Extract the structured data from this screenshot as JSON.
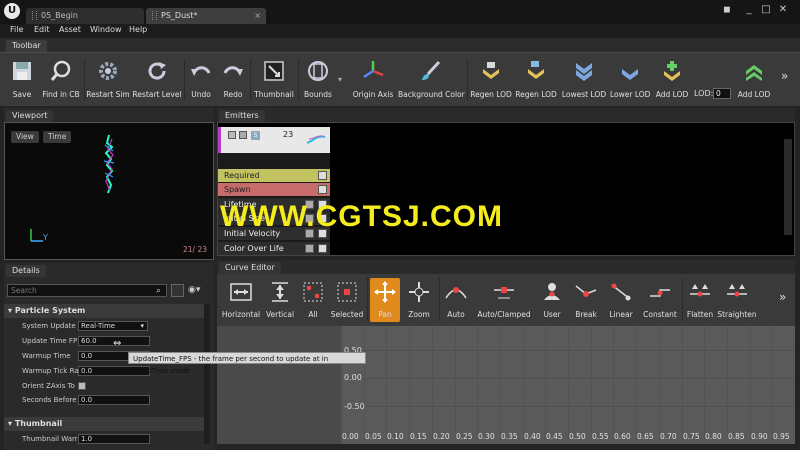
{
  "tabs": [
    {
      "label": "05_Begin"
    },
    {
      "label": "PS_Dust*"
    }
  ],
  "menu": [
    "File",
    "Edit",
    "Asset",
    "Window",
    "Help"
  ],
  "toolbar": {
    "title": "Toolbar",
    "buttons": [
      {
        "label": "Save",
        "icon": "save-icon"
      },
      {
        "label": "Find in CB",
        "icon": "magnifier-icon"
      },
      {
        "label": "Restart Sim",
        "icon": "gear-restart-icon"
      },
      {
        "label": "Restart Level",
        "icon": "refresh-icon"
      },
      {
        "label": "Undo",
        "icon": "undo-icon"
      },
      {
        "label": "Redo",
        "icon": "redo-icon"
      },
      {
        "label": "Thumbnail",
        "icon": "thumbnail-icon"
      },
      {
        "label": "Bounds",
        "icon": "bounds-icon"
      },
      {
        "label": "Origin Axis",
        "icon": "axis-icon"
      },
      {
        "label": "Background Color",
        "icon": "brush-icon"
      },
      {
        "label": "Regen LOD",
        "icon": "regen-lod-icon"
      },
      {
        "label": "Regen LOD",
        "icon": "regen-lod-icon"
      },
      {
        "label": "Lowest LOD",
        "icon": "lowest-lod-icon"
      },
      {
        "label": "Lower LOD",
        "icon": "lower-lod-icon"
      },
      {
        "label": "Add LOD",
        "icon": "add-lod-icon"
      },
      {
        "label": "Add LOD",
        "icon": "add-lod-icon"
      }
    ],
    "lod_label": "LOD:",
    "lod_value": "0"
  },
  "viewport": {
    "title": "Viewport",
    "view_btn": "View",
    "time_btn": "Time",
    "axis_y": "Y",
    "frame_counter": "21/ 23"
  },
  "details": {
    "title": "Details",
    "search_placeholder": "Search",
    "section_particle": "Particle System",
    "props": [
      {
        "label": "System Update",
        "value": "Real-Time"
      },
      {
        "label": "Update Time FP",
        "value": "60.0"
      },
      {
        "label": "Warmup Time",
        "value": "0.0"
      },
      {
        "label": "Warmup Tick Ra",
        "value": "0.0"
      },
      {
        "label": "Orient ZAxis To",
        "value": ""
      },
      {
        "label": "Seconds Before",
        "value": "0.0"
      }
    ],
    "section_thumbnail": "Thumbnail",
    "thumb_label": "Thumbnail Warr",
    "thumb_value": "1.0"
  },
  "tooltip": "UpdateTime_FPS - the frame per second to update at in FixedTime mode",
  "emitters": {
    "title": "Emitters",
    "count": "23",
    "modules": [
      "Required",
      "Spawn",
      "Lifetime",
      "Initial Size",
      "Initial Velocity",
      "Color Over Life"
    ]
  },
  "curve_editor": {
    "title": "Curve Editor",
    "buttons": [
      {
        "label": "Horizontal",
        "icon": "fit-horizontal-icon"
      },
      {
        "label": "Vertical",
        "icon": "fit-vertical-icon"
      },
      {
        "label": "All",
        "icon": "fit-all-icon"
      },
      {
        "label": "Selected",
        "icon": "fit-selected-icon"
      },
      {
        "label": "Pan",
        "icon": "pan-icon"
      },
      {
        "label": "Zoom",
        "icon": "zoom-icon"
      },
      {
        "label": "Auto",
        "icon": "auto-tangent-icon"
      },
      {
        "label": "Auto/Clamped",
        "icon": "auto-clamped-icon"
      },
      {
        "label": "User",
        "icon": "user-tangent-icon"
      },
      {
        "label": "Break",
        "icon": "break-tangent-icon"
      },
      {
        "label": "Linear",
        "icon": "linear-icon"
      },
      {
        "label": "Constant",
        "icon": "constant-icon"
      },
      {
        "label": "Flatten",
        "icon": "flatten-icon"
      },
      {
        "label": "Straighten",
        "icon": "straighten-icon"
      }
    ],
    "y_labels": [
      "0.50",
      "0.00",
      "-0.50"
    ],
    "x_labels": [
      "0.00",
      "0.05",
      "0.10",
      "0.15",
      "0.20",
      "0.25",
      "0.30",
      "0.35",
      "0.40",
      "0.45",
      "0.50",
      "0.55",
      "0.60",
      "0.65",
      "0.70",
      "0.75",
      "0.80",
      "0.85",
      "0.90",
      "0.95"
    ]
  },
  "watermark": "WWW.CGTSJ.COM",
  "colors": {
    "accent": "#e08a1e",
    "required": "#c2c260",
    "spawn": "#c86b6b",
    "watermark": "#f4ec1c"
  }
}
